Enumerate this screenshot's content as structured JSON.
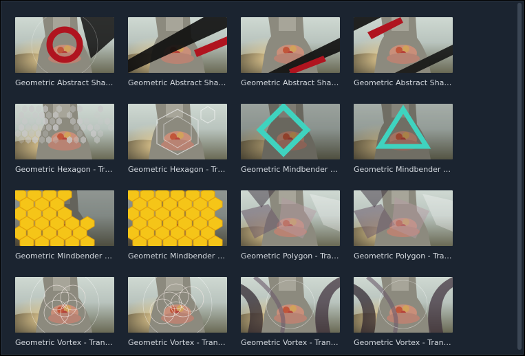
{
  "items": [
    {
      "title": "Geometric Abstract Shap...",
      "effect": "red-ring"
    },
    {
      "title": "Geometric Abstract Shap...",
      "effect": "red-bar"
    },
    {
      "title": "Geometric Abstract Shap...",
      "effect": "red-bar-low"
    },
    {
      "title": "Geometric Abstract Shap...",
      "effect": "red-bar-top"
    },
    {
      "title": "Geometric Hexagon - Tra...",
      "effect": "hex-tiles"
    },
    {
      "title": "Geometric Hexagon - Tra...",
      "effect": "hex-outline"
    },
    {
      "title": "Geometric Mindbender - ...",
      "effect": "teal-diamond"
    },
    {
      "title": "Geometric Mindbender - ...",
      "effect": "teal-triangle"
    },
    {
      "title": "Geometric Mindbender - ...",
      "effect": "yellow-hex"
    },
    {
      "title": "Geometric Mindbender - ...",
      "effect": "yellow-hex-2"
    },
    {
      "title": "Geometric Polygon - Tran...",
      "effect": "polygon"
    },
    {
      "title": "Geometric Polygon - Tran...",
      "effect": "polygon-2"
    },
    {
      "title": "Geometric Vortex - Transi...",
      "effect": "vortex-rings"
    },
    {
      "title": "Geometric Vortex - Transi...",
      "effect": "vortex-rings-2"
    },
    {
      "title": "Geometric Vortex - Transi...",
      "effect": "vortex-swirl"
    },
    {
      "title": "Geometric Vortex - Transi...",
      "effect": "vortex-swirl-2"
    }
  ],
  "colors": {
    "background": "#1b2430",
    "label": "#d3d8de",
    "accent_red": "#b0141f",
    "accent_teal": "#3fd3bf",
    "accent_yellow": "#f5c518"
  }
}
